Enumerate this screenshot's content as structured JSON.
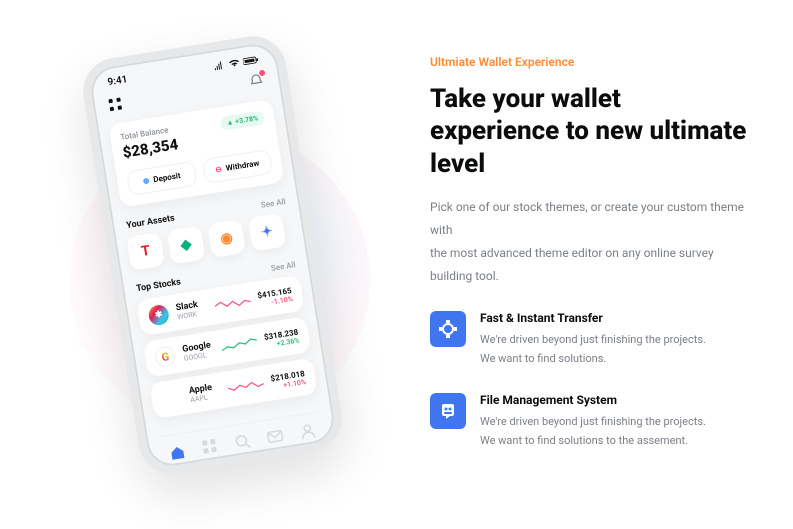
{
  "phone": {
    "status_time": "9:41",
    "balance": {
      "label": "Total Balance",
      "amount": "$28,354",
      "pct": "+3.78%"
    },
    "actions": {
      "deposit": "Deposit",
      "withdraw": "Withdraw"
    },
    "assets": {
      "title": "Your Assets",
      "see_all": "See All",
      "items": [
        "tesla",
        "neo",
        "rocket",
        "blob"
      ]
    },
    "stocks": {
      "title": "Top Stocks",
      "see_all": "See All",
      "list": [
        {
          "name": "Slack",
          "ticker": "WORK",
          "price": "$415.165",
          "change": "-1.10%",
          "dir": "dn",
          "spark_color": "#ff4d7a"
        },
        {
          "name": "Google",
          "ticker": "GOOGL",
          "price": "$318.238",
          "change": "+2.36%",
          "dir": "up",
          "spark_color": "#1fbf75"
        },
        {
          "name": "Apple",
          "ticker": "AAPL",
          "price": "$218.018",
          "change": "+1.10%",
          "dir": "dn",
          "spark_color": "#ff4d7a"
        }
      ]
    }
  },
  "marketing": {
    "eyebrow": "Ultmiate Wallet Experience",
    "headline": "Take your wallet experience to new ultimate level",
    "desc_l1": "Pick one of our stock themes, or create your custom theme with",
    "desc_l2": "the most advanced theme editor on any online survey building tool.",
    "features": [
      {
        "title": "Fast & Instant Transfer",
        "text_l1": "We're driven beyond just finishing the projects.",
        "text_l2": "We want to find solutions."
      },
      {
        "title": "File Management System",
        "text_l1": "We're driven beyond just finishing the projects.",
        "text_l2": "We want to find solutions to the assement."
      }
    ]
  },
  "colors": {
    "accent": "#ff8a34",
    "brand_blue": "#3f76f0",
    "up": "#1fbf75",
    "down": "#ff4d7a"
  }
}
